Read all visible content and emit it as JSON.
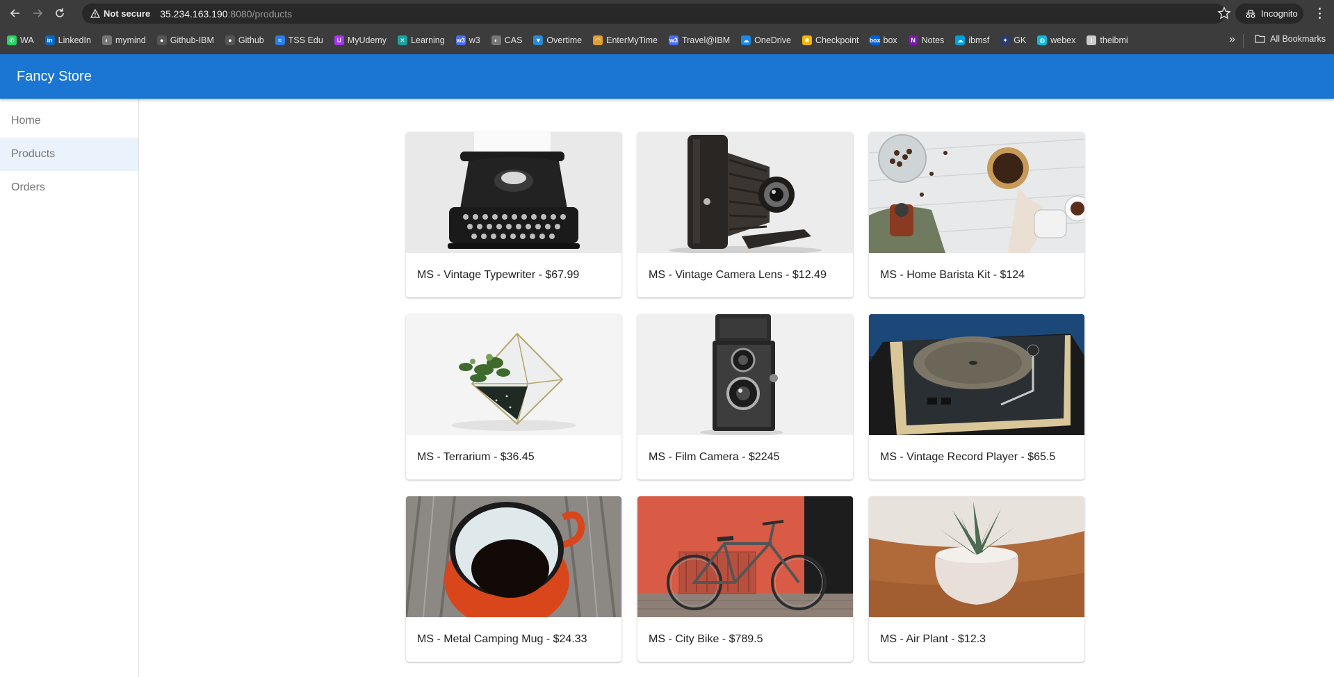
{
  "browser": {
    "security_label": "Not secure",
    "url_host": "35.234.163.190",
    "url_rest": ":8080/products",
    "incognito_label": "Incognito",
    "all_bookmarks_label": "All Bookmarks"
  },
  "bookmarks": [
    {
      "label": "WA",
      "icon": "whatsapp-icon",
      "color": "#25d366",
      "glyph": "✆"
    },
    {
      "label": "LinkedIn",
      "icon": "linkedin-icon",
      "color": "#0a66c2",
      "glyph": "in"
    },
    {
      "label": "mymind",
      "icon": "globe-icon",
      "color": "#777777",
      "glyph": "◐"
    },
    {
      "label": "Github-IBM",
      "icon": "github-icon",
      "color": "#555555",
      "glyph": "●"
    },
    {
      "label": "Github",
      "icon": "github-icon",
      "color": "#555555",
      "glyph": "●"
    },
    {
      "label": "TSS Edu",
      "icon": "tss-icon",
      "color": "#2b7de9",
      "glyph": "≈"
    },
    {
      "label": "MyUdemy",
      "icon": "udemy-icon",
      "color": "#a435f0",
      "glyph": "U"
    },
    {
      "label": "Learning",
      "icon": "learning-icon",
      "color": "#1aa3a3",
      "glyph": "✕"
    },
    {
      "label": "w3",
      "icon": "w3-icon",
      "color": "#4a6cf7",
      "glyph": "w3"
    },
    {
      "label": "CAS",
      "icon": "globe-icon",
      "color": "#777777",
      "glyph": "◐"
    },
    {
      "label": "Overtime",
      "icon": "overtime-icon",
      "color": "#2c8ad6",
      "glyph": "▼"
    },
    {
      "label": "EnterMyTime",
      "icon": "entermytime-icon",
      "color": "#e0a030",
      "glyph": "◠"
    },
    {
      "label": "Travel@IBM",
      "icon": "w3-icon",
      "color": "#4a6cf7",
      "glyph": "w3"
    },
    {
      "label": "OneDrive",
      "icon": "onedrive-icon",
      "color": "#1e88e5",
      "glyph": "☁"
    },
    {
      "label": "Checkpoint",
      "icon": "checkpoint-icon",
      "color": "#f5b400",
      "glyph": "✱"
    },
    {
      "label": "box",
      "icon": "box-icon",
      "color": "#0061d5",
      "glyph": "box"
    },
    {
      "label": "Notes",
      "icon": "onenote-icon",
      "color": "#7719aa",
      "glyph": "N"
    },
    {
      "label": "ibmsf",
      "icon": "salesforce-icon",
      "color": "#00a1e0",
      "glyph": "☁"
    },
    {
      "label": "GK",
      "icon": "gk-icon",
      "color": "#2a3b6b",
      "glyph": "✦"
    },
    {
      "label": "webex",
      "icon": "webex-icon",
      "color": "#0fb8d8",
      "glyph": "◍"
    },
    {
      "label": "theibmi",
      "icon": "theibmi-icon",
      "color": "#cccccc",
      "glyph": "i"
    }
  ],
  "app": {
    "title": "Fancy Store",
    "primary_color": "#1a76d2"
  },
  "sidebar": {
    "items": [
      {
        "label": "Home",
        "active": false
      },
      {
        "label": "Products",
        "active": true
      },
      {
        "label": "Orders",
        "active": false
      }
    ]
  },
  "products": [
    {
      "label": "MS - Vintage Typewriter - $67.99",
      "image": "typewriter-image"
    },
    {
      "label": "MS - Vintage Camera Lens - $12.49",
      "image": "folding-camera-image"
    },
    {
      "label": "MS - Home Barista Kit - $124",
      "image": "barista-kit-image"
    },
    {
      "label": "MS - Terrarium - $36.45",
      "image": "terrarium-image"
    },
    {
      "label": "MS - Film Camera - $2245",
      "image": "film-camera-image"
    },
    {
      "label": "MS - Vintage Record Player - $65.5",
      "image": "record-player-image"
    },
    {
      "label": "MS - Metal Camping Mug - $24.33",
      "image": "camping-mug-image"
    },
    {
      "label": "MS - City Bike - $789.5",
      "image": "city-bike-image"
    },
    {
      "label": "MS - Air Plant - $12.3",
      "image": "air-plant-image"
    }
  ]
}
